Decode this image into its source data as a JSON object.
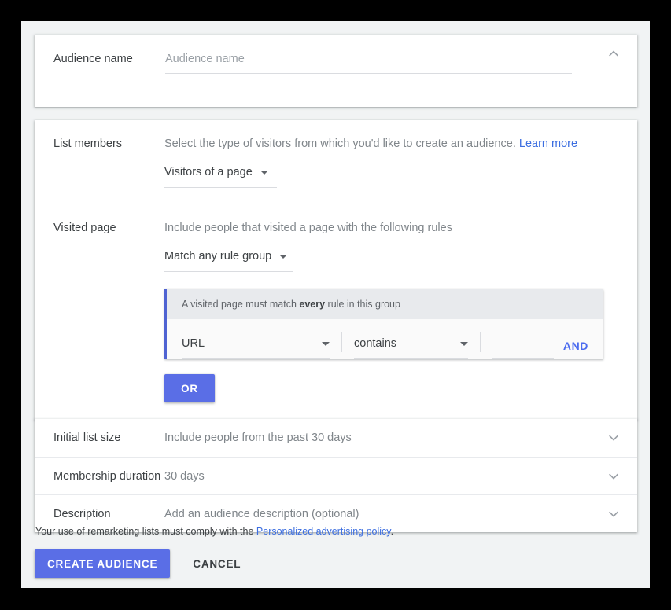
{
  "theme": {
    "page_background": "#f1f3f4",
    "card_background": "#ffffff",
    "accent_button": "#5a6ee6",
    "accent_rule_bar": "#4f63d2",
    "link_color": "#3c6ee0",
    "and_link_color": "#4b6bef",
    "muted_text": "#80868b",
    "primary_text": "#3c4043"
  },
  "audience_name": {
    "label": "Audience name",
    "placeholder": "Audience name",
    "value": "",
    "collapse_icon": "chevron-up-icon"
  },
  "list_members": {
    "label": "List members",
    "description": "Select the type of visitors from which you'd like to create an audience.",
    "learn_more": "Learn more",
    "selected": "Visitors of a page"
  },
  "visited_page": {
    "label": "Visited page",
    "description": "Include people that visited a page with the following rules",
    "match_type_selected": "Match any rule group",
    "rule_group": {
      "header_prefix": "A visited page must match ",
      "header_bold": "every",
      "header_suffix": " rule in this group",
      "dimension": "URL",
      "operator": "contains",
      "value": "",
      "value_placeholder": "",
      "and_label": "AND"
    },
    "or_label": "OR"
  },
  "collapsed_rows": [
    {
      "label": "Initial list size",
      "value": "Include people from the past 30 days",
      "expand_icon": "chevron-down-icon"
    },
    {
      "label": "Membership duration",
      "value": "30 days",
      "expand_icon": "chevron-down-icon"
    },
    {
      "label": "Description",
      "value": "Add an audience description (optional)",
      "expand_icon": "chevron-down-icon"
    }
  ],
  "footer": {
    "policy_prefix": "Your use of remarketing lists must comply with the ",
    "policy_link": "Personalized advertising policy",
    "policy_suffix": ".",
    "create_label": "CREATE AUDIENCE",
    "cancel_label": "CANCEL"
  }
}
